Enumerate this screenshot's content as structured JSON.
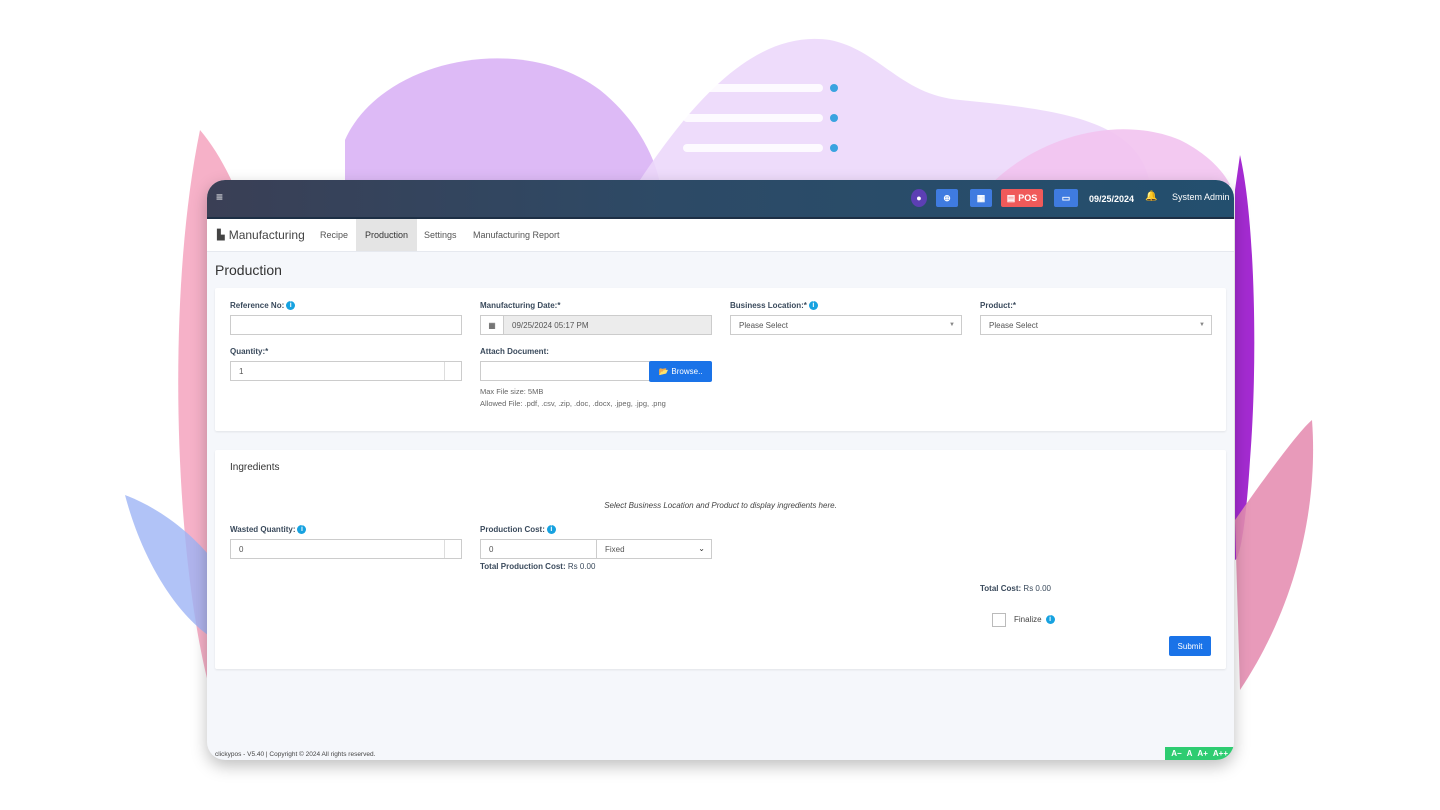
{
  "topbar": {
    "pos_label": "POS",
    "date": "09/25/2024",
    "user": "System Admin"
  },
  "subnav": {
    "brand": "Manufacturing",
    "links": [
      "Recipe",
      "Production",
      "Settings",
      "Manufacturing Report"
    ]
  },
  "page": {
    "title": "Production"
  },
  "form": {
    "reference_label": "Reference No:",
    "reference_value": "",
    "mfg_date_label": "Manufacturing Date:*",
    "mfg_date_value": "09/25/2024 05:17 PM",
    "location_label": "Business Location:*",
    "location_value": "Please Select",
    "product_label": "Product:*",
    "product_value": "Please Select",
    "quantity_label": "Quantity:*",
    "quantity_value": "1",
    "attach_label": "Attach Document:",
    "browse_label": "Browse..",
    "max_size": "Max File size: 5MB",
    "allowed": "Allowed File: .pdf, .csv, .zip, .doc, .docx, .jpeg, .jpg, .png"
  },
  "ingredients": {
    "title": "Ingredients",
    "empty_msg": "Select Business Location and Product to display ingredients here.",
    "wasted_label": "Wasted Quantity:",
    "wasted_value": "0",
    "cost_label": "Production Cost:",
    "cost_value": "0",
    "cost_type": "Fixed",
    "total_prod_cost_label": "Total Production Cost:",
    "total_prod_cost_value": "Rs 0.00",
    "total_cost_label": "Total Cost:",
    "total_cost_value": "Rs 0.00",
    "finalize_label": "Finalize",
    "submit_label": "Submit"
  },
  "footer": {
    "text": "clickypos - V5.40 | Copyright © 2024 All rights reserved.",
    "a11y": [
      "A−",
      "A",
      "A+",
      "A++"
    ]
  },
  "colors": {
    "accent": "#1a73e8",
    "pos_red": "#f05a5a",
    "info": "#17a2e0",
    "a11y_green": "#2ecc71"
  }
}
